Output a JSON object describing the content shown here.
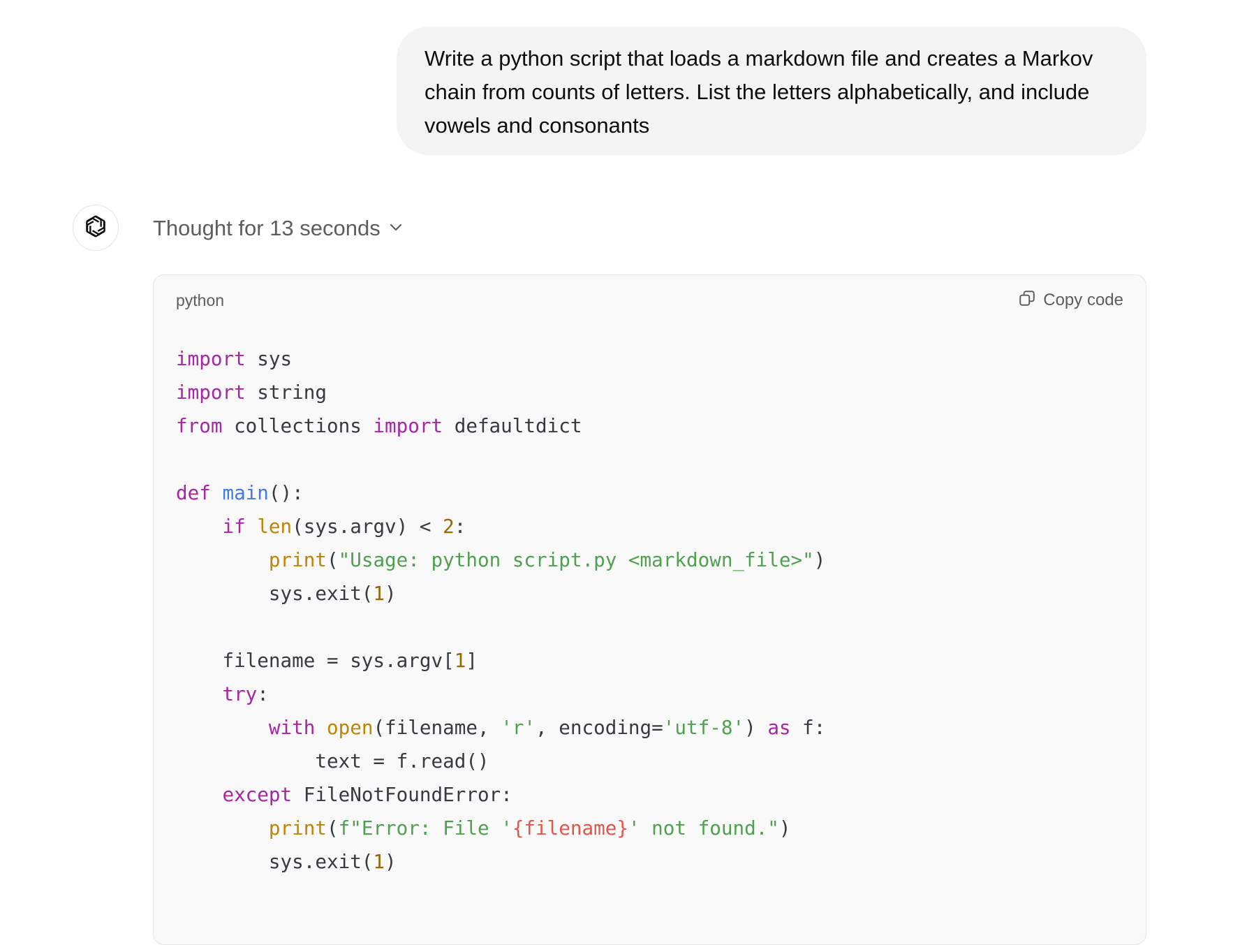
{
  "user_message": {
    "text": "Write a python script that loads a markdown file and creates a Markov chain from counts of letters. List the letters alphabetically, and include vowels and consonants"
  },
  "assistant": {
    "avatar_icon": "openai-logo-icon",
    "thought_label": "Thought for 13 seconds",
    "thought_toggle_icon": "chevron-down-icon"
  },
  "code_block": {
    "language": "python",
    "copy_label": "Copy code",
    "copy_icon": "copy-icon",
    "lines": [
      [
        {
          "t": "import",
          "c": "kw"
        },
        {
          "t": " sys",
          "c": "plain"
        }
      ],
      [
        {
          "t": "import",
          "c": "kw"
        },
        {
          "t": " string",
          "c": "plain"
        }
      ],
      [
        {
          "t": "from",
          "c": "kw"
        },
        {
          "t": " collections ",
          "c": "plain"
        },
        {
          "t": "import",
          "c": "kw"
        },
        {
          "t": " defaultdict",
          "c": "plain"
        }
      ],
      [],
      [
        {
          "t": "def",
          "c": "kw"
        },
        {
          "t": " ",
          "c": "plain"
        },
        {
          "t": "main",
          "c": "fn"
        },
        {
          "t": "():",
          "c": "plain"
        }
      ],
      [
        {
          "t": "    ",
          "c": "plain"
        },
        {
          "t": "if",
          "c": "kw"
        },
        {
          "t": " ",
          "c": "plain"
        },
        {
          "t": "len",
          "c": "bi"
        },
        {
          "t": "(sys.argv) < ",
          "c": "plain"
        },
        {
          "t": "2",
          "c": "num"
        },
        {
          "t": ":",
          "c": "plain"
        }
      ],
      [
        {
          "t": "        ",
          "c": "plain"
        },
        {
          "t": "print",
          "c": "bi"
        },
        {
          "t": "(",
          "c": "plain"
        },
        {
          "t": "\"Usage: python script.py <markdown_file>\"",
          "c": "str"
        },
        {
          "t": ")",
          "c": "plain"
        }
      ],
      [
        {
          "t": "        sys.exit(",
          "c": "plain"
        },
        {
          "t": "1",
          "c": "num"
        },
        {
          "t": ")",
          "c": "plain"
        }
      ],
      [],
      [
        {
          "t": "    filename = sys.argv[",
          "c": "plain"
        },
        {
          "t": "1",
          "c": "num"
        },
        {
          "t": "]",
          "c": "plain"
        }
      ],
      [
        {
          "t": "    ",
          "c": "plain"
        },
        {
          "t": "try",
          "c": "kw"
        },
        {
          "t": ":",
          "c": "plain"
        }
      ],
      [
        {
          "t": "        ",
          "c": "plain"
        },
        {
          "t": "with",
          "c": "kw"
        },
        {
          "t": " ",
          "c": "plain"
        },
        {
          "t": "open",
          "c": "bi"
        },
        {
          "t": "(filename, ",
          "c": "plain"
        },
        {
          "t": "'r'",
          "c": "str"
        },
        {
          "t": ", encoding=",
          "c": "plain"
        },
        {
          "t": "'utf-8'",
          "c": "str"
        },
        {
          "t": ") ",
          "c": "plain"
        },
        {
          "t": "as",
          "c": "kw"
        },
        {
          "t": " f:",
          "c": "plain"
        }
      ],
      [
        {
          "t": "            text = f.read()",
          "c": "plain"
        }
      ],
      [
        {
          "t": "    ",
          "c": "plain"
        },
        {
          "t": "except",
          "c": "kw"
        },
        {
          "t": " FileNotFoundError:",
          "c": "plain"
        }
      ],
      [
        {
          "t": "        ",
          "c": "plain"
        },
        {
          "t": "print",
          "c": "bi"
        },
        {
          "t": "(",
          "c": "plain"
        },
        {
          "t": "f\"Error: File '",
          "c": "str"
        },
        {
          "t": "{filename}",
          "c": "sub"
        },
        {
          "t": "' not found.\"",
          "c": "str"
        },
        {
          "t": ")",
          "c": "plain"
        }
      ],
      [
        {
          "t": "        sys.exit(",
          "c": "plain"
        },
        {
          "t": "1",
          "c": "num"
        },
        {
          "t": ")",
          "c": "plain"
        }
      ],
      []
    ]
  },
  "colors": {
    "bubble_bg": "#f4f4f4",
    "code_bg": "#f9f9f9",
    "keyword": "#a626a4",
    "function": "#4078f2",
    "builtin": "#c18401",
    "string": "#50a14f",
    "number": "#986801",
    "substitution": "#e45649"
  }
}
